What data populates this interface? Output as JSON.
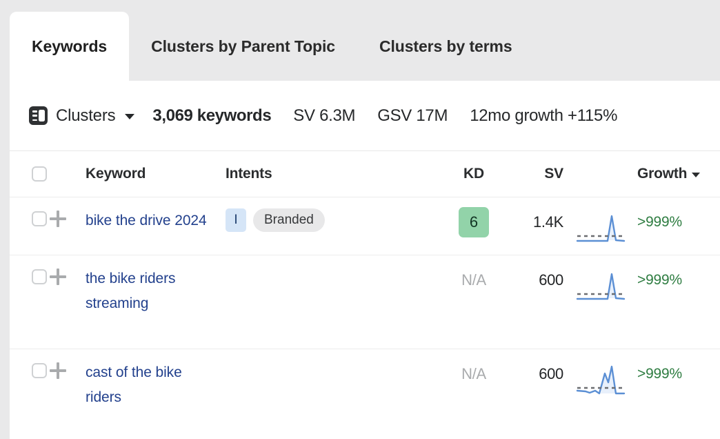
{
  "tabs": [
    {
      "label": "Keywords",
      "active": true
    },
    {
      "label": "Clusters by Parent Topic",
      "active": false
    },
    {
      "label": "Clusters by terms",
      "active": false
    }
  ],
  "toolbar": {
    "panel_icon": "panel-layout-icon",
    "clusters_label": "Clusters",
    "caret_icon": "chevron-down-icon",
    "keywords_count": "3,069 keywords",
    "sv_total": "SV 6.3M",
    "gsv_total": "GSV 17M",
    "growth_12mo": "12mo growth +115%"
  },
  "table": {
    "columns": {
      "keyword": "Keyword",
      "intents": "Intents",
      "kd": "KD",
      "sv": "SV",
      "growth": "Growth",
      "sort_icon": "chevron-down-icon"
    },
    "rows": [
      {
        "keyword": "bike the drive 2024",
        "intents": [
          {
            "type": "letter",
            "label": "I",
            "color": "#d5e5f7"
          },
          {
            "type": "pill",
            "label": "Branded",
            "color": "#e8e8e9"
          }
        ],
        "kd": "6",
        "kd_color": "#92d3a9",
        "sv": "1.4K",
        "growth": ">999%",
        "growth_color": "#2f7d42",
        "spark": "single-peak"
      },
      {
        "keyword": "the bike riders streaming",
        "intents": [],
        "kd": "N/A",
        "kd_color": "",
        "sv": "600",
        "growth": ">999%",
        "growth_color": "#2f7d42",
        "spark": "single-peak"
      },
      {
        "keyword": "cast of the bike riders",
        "intents": [],
        "kd": "N/A",
        "kd_color": "",
        "sv": "600",
        "growth": ">999%",
        "growth_color": "#2f7d42",
        "spark": "double-peak"
      }
    ]
  }
}
